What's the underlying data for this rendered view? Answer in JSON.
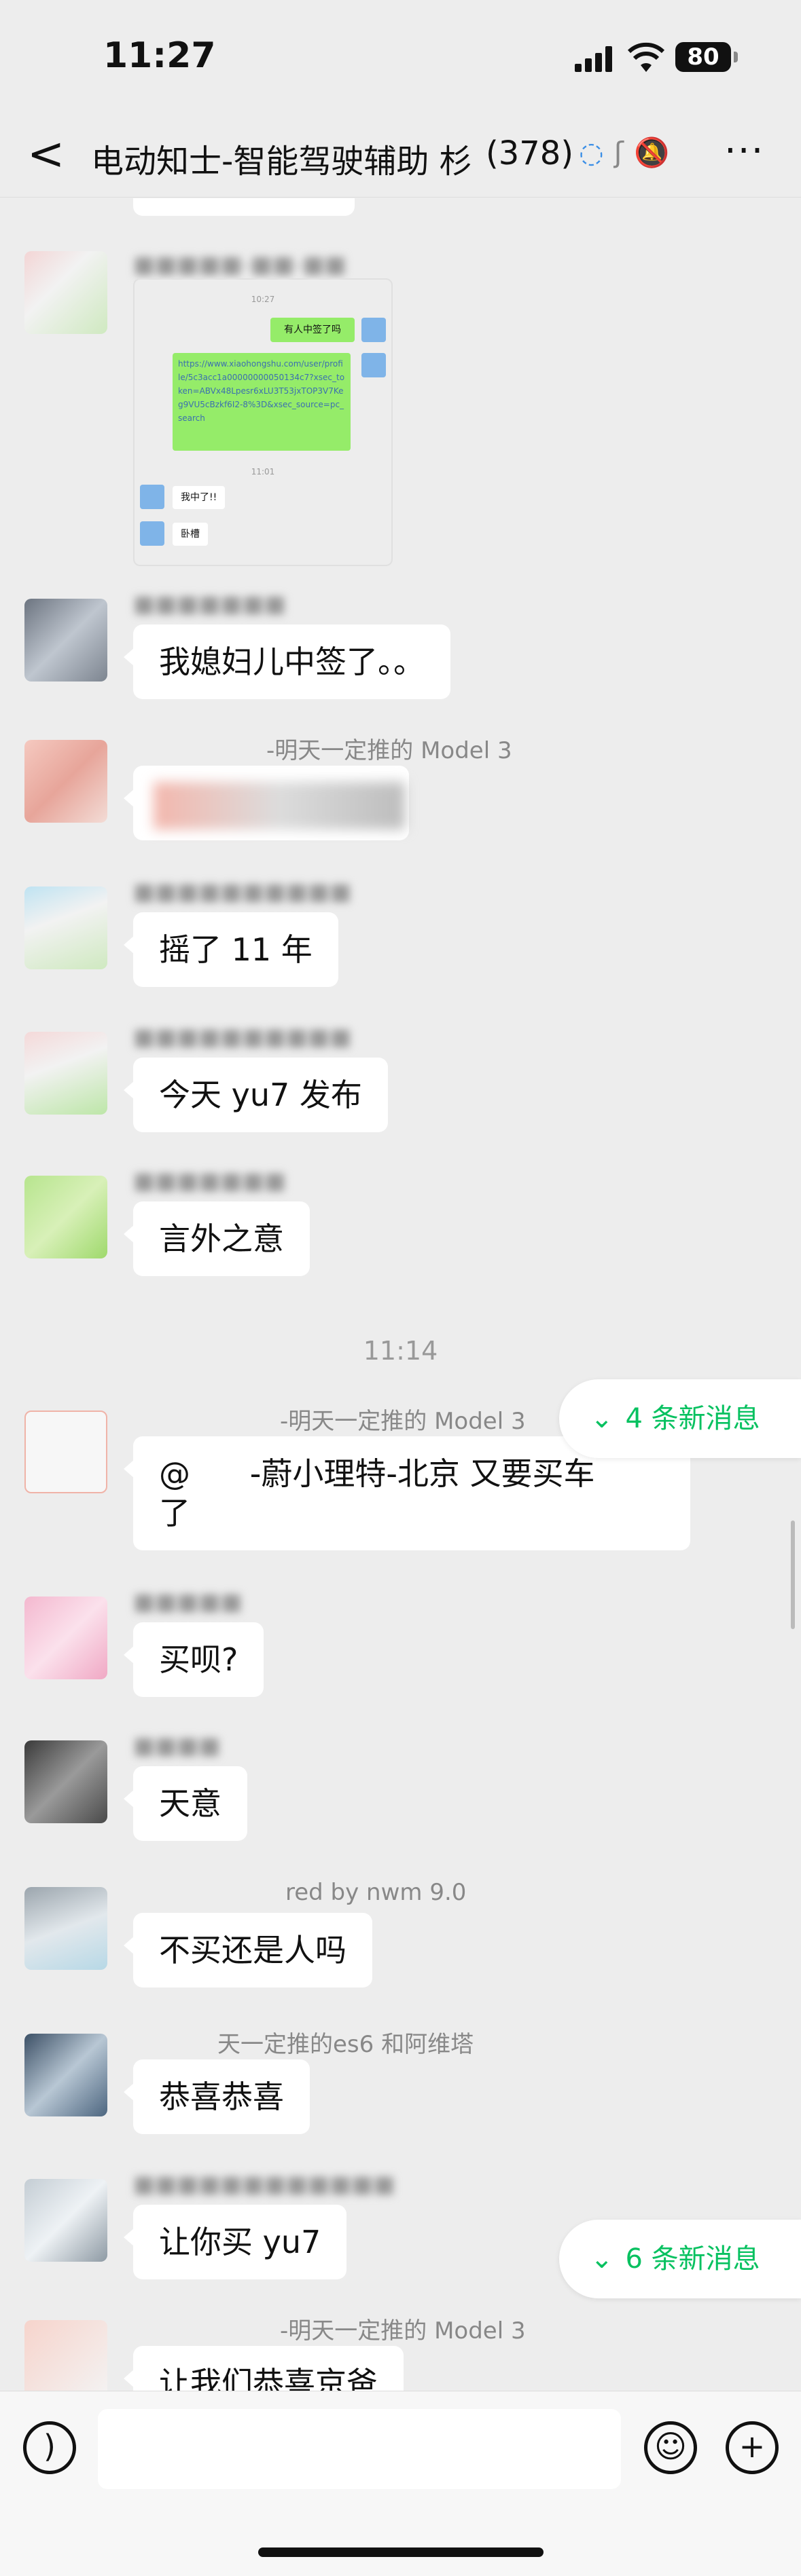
{
  "status_bar": {
    "time": "11:27",
    "battery": "80"
  },
  "nav": {
    "back": "<",
    "title": "电动知士-智能驾驶辅助 杉",
    "count": "(378)",
    "more": "···"
  },
  "image_message": {
    "time1": "10:27",
    "green1": "有人中签了吗",
    "link": "https://www.xiaohongshu.com/user/profile/5c3acc1a00000000050134c7?xsec_token=ABVx48Lpesr6xLU3T53jxTOP3V7Keg9VU5cBzkf6I2-8%3D&xsec_source=pc_search",
    "time2": "11:01",
    "reply1": "我中了!!",
    "reply2": "卧槽"
  },
  "messages": [
    {
      "sender": "",
      "text": "我媳妇儿中签了。。"
    },
    {
      "sender": "-明天一定推的 Model 3",
      "text": ""
    },
    {
      "sender": "",
      "text": "摇了 11 年"
    },
    {
      "sender": "",
      "text": "今天 yu7 发布"
    },
    {
      "sender": "",
      "text": "言外之意"
    },
    {
      "sender": "-明天一定推的 Model 3",
      "text": "@      -蔚小理特-北京 又要买车\n了"
    },
    {
      "sender": "",
      "text": "买呗?"
    },
    {
      "sender": "",
      "text": "天意"
    },
    {
      "sender": "red  by nwm 9.0",
      "text": "不买还是人吗"
    },
    {
      "sender": "天一定推的es6 和阿维塔",
      "text": "恭喜恭喜"
    },
    {
      "sender": "",
      "text": "让你买 yu7"
    },
    {
      "sender": "-明天一定推的 Model 3",
      "text": "让我们恭喜京爸"
    }
  ],
  "timestamp": "11:14",
  "new_msgs_1": "4 条新消息",
  "new_msgs_2": "6 条新消息",
  "input": {
    "voice_icon": "voice-icon",
    "emoji_icon": "emoji-icon",
    "plus_icon": "plus-icon"
  },
  "colors": {
    "background": "#ededed",
    "bubble": "#ffffff",
    "accent": "#07c160",
    "self_bubble": "#95ec69"
  }
}
